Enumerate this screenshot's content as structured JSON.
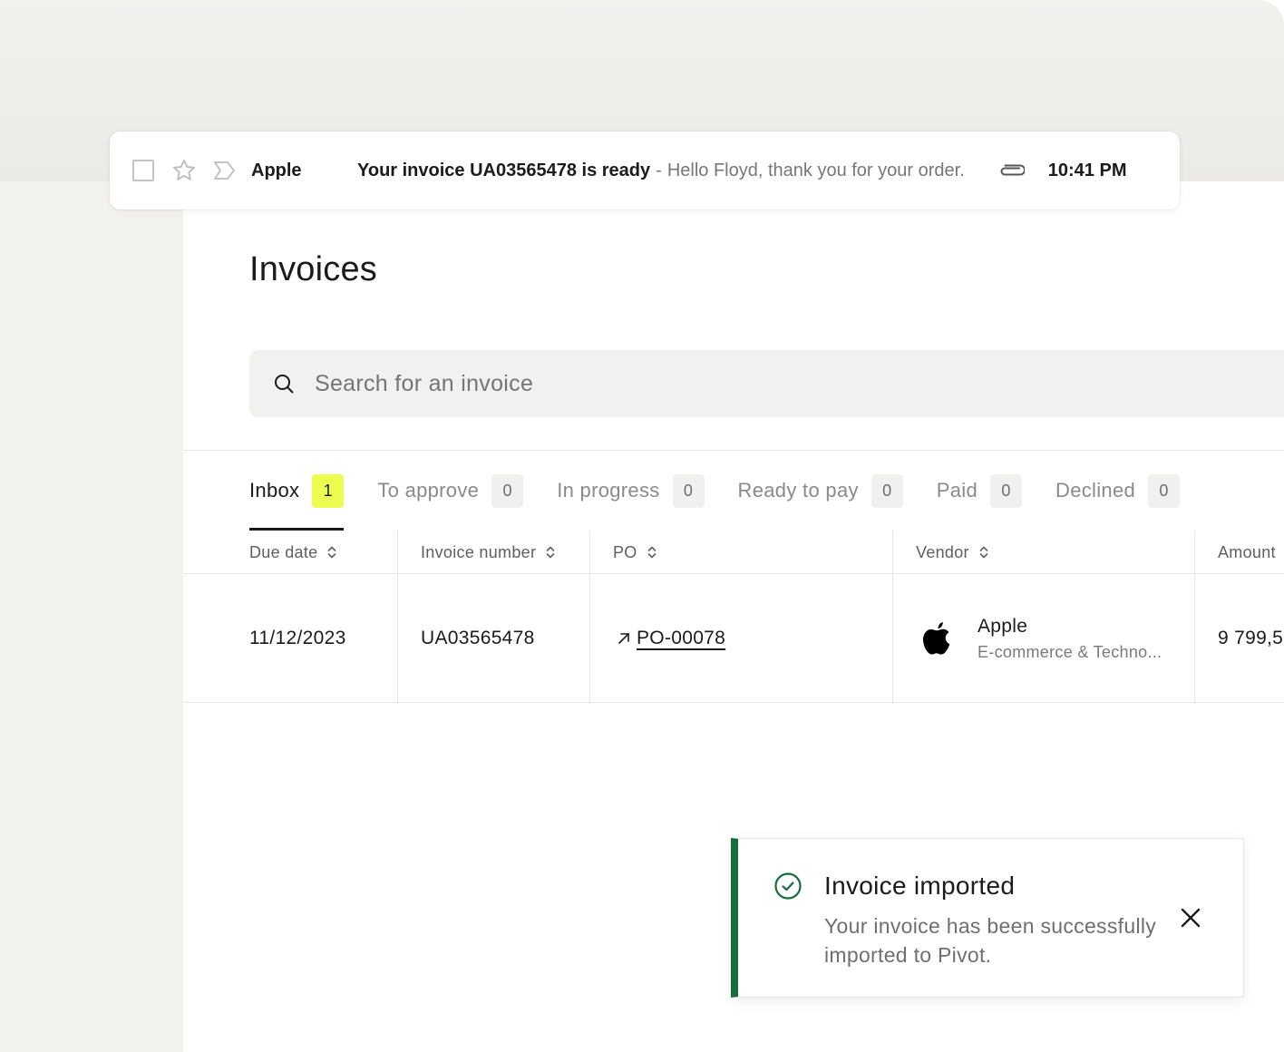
{
  "email": {
    "sender": "Apple",
    "subject": "Your invoice UA03565478 is ready",
    "separator": "-",
    "snippet": "Hello Floyd, thank you for your order.",
    "time": "10:41 PM"
  },
  "page": {
    "title": "Invoices"
  },
  "search": {
    "placeholder": "Search for an invoice"
  },
  "tabs": [
    {
      "label": "Inbox",
      "count": "1",
      "active": true
    },
    {
      "label": "To approve",
      "count": "0"
    },
    {
      "label": "In progress",
      "count": "0"
    },
    {
      "label": "Ready to pay",
      "count": "0"
    },
    {
      "label": "Paid",
      "count": "0"
    },
    {
      "label": "Declined",
      "count": "0"
    }
  ],
  "table": {
    "columns": [
      "Due date",
      "Invoice number",
      "PO",
      "Vendor",
      "Amount"
    ],
    "rows": [
      {
        "due_date": "11/12/2023",
        "invoice_number": "UA03565478",
        "po": "PO-00078",
        "vendor_name": "Apple",
        "vendor_category": "E-commerce & Techno...",
        "amount": "9 799,5"
      }
    ]
  },
  "toast": {
    "title": "Invoice imported",
    "message": "Your invoice has been successfully imported to Pivot."
  },
  "colors": {
    "accent_badge": "#edfd50",
    "success": "#1a6b3e",
    "background": "#f3f2ef"
  }
}
